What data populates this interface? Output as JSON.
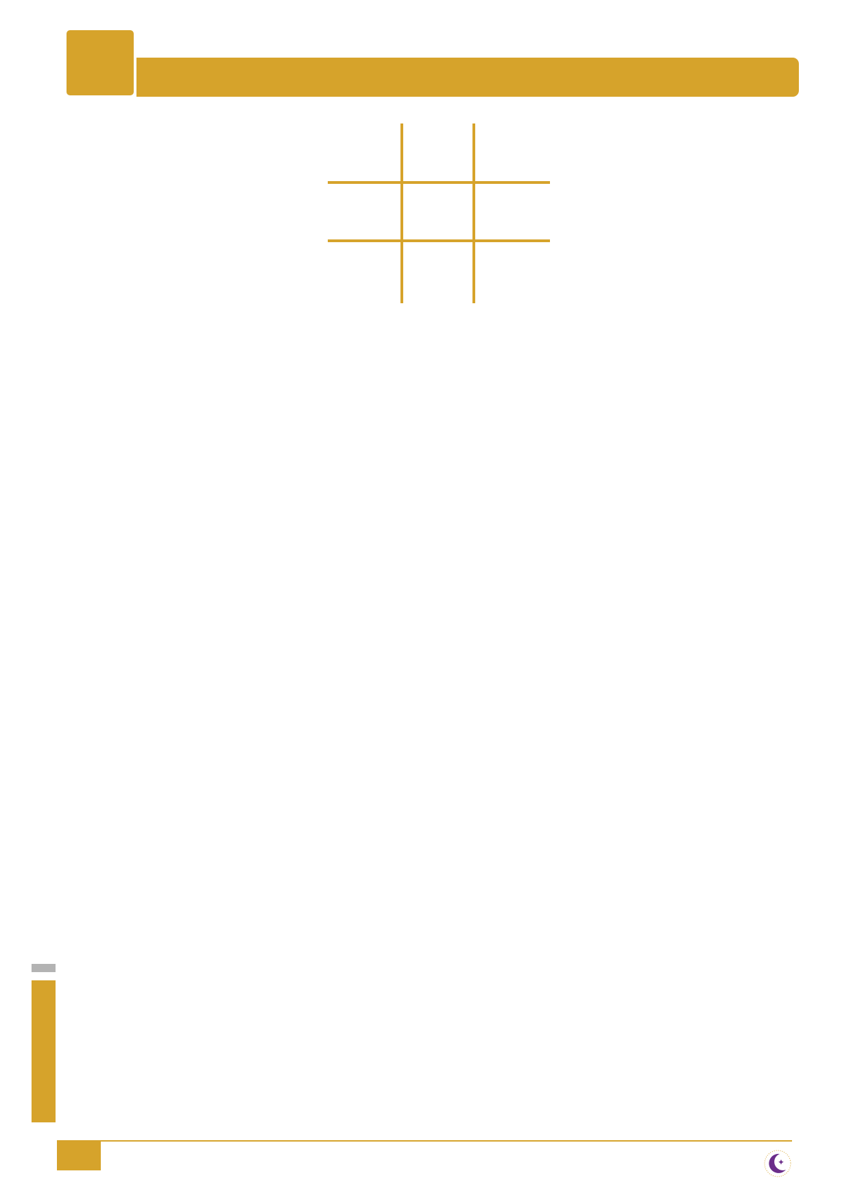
{
  "theme": {
    "accent": "#D6A32B",
    "muted": "#B3B3B3",
    "logo_color": "#6B2D8A"
  },
  "header": {
    "chapter_number": "",
    "title": ""
  },
  "grid": {
    "rows": 3,
    "columns": 3,
    "cells": [
      [
        "",
        "",
        ""
      ],
      [
        "",
        "",
        ""
      ],
      [
        "",
        "",
        ""
      ]
    ]
  },
  "footer": {
    "page_number": "",
    "logo_icon": "crescent-star-icon"
  }
}
